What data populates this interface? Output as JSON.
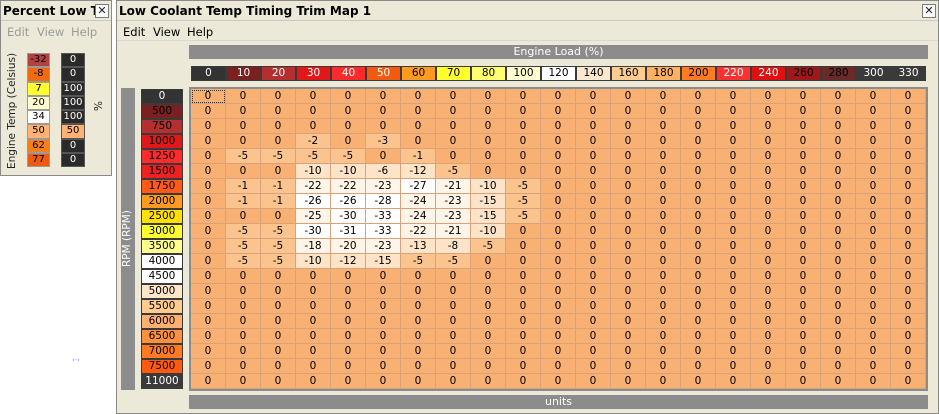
{
  "left_window": {
    "title": "Percent Low T...",
    "close": "✕",
    "menu": [
      "Edit",
      "View",
      "Help"
    ],
    "temp_label": "Engine Temp (Celsius)",
    "pct_label": "%",
    "temps": [
      "-32",
      "-8",
      "7",
      "20",
      "34",
      "50",
      "62",
      "77"
    ],
    "temp_colors": [
      "#b44040",
      "#f26a10",
      "#ffff30",
      "#fffdd0",
      "#ffffff",
      "#ffb273",
      "#f77f1b",
      "#ee5a10"
    ],
    "percents": [
      "0",
      "0",
      "100",
      "100",
      "100",
      "50",
      "0",
      "0"
    ],
    "percent_colors": [
      "#2a2a2a",
      "#2a2a2a",
      "#2a2a2a",
      "#2a2a2a",
      "#2a2a2a",
      "#ffb273",
      "#2a2a2a",
      "#2a2a2a"
    ],
    "percent_text_colors": [
      "#ffffff",
      "#ffffff",
      "#ffffff",
      "#ffffff",
      "#ffffff",
      "#000000",
      "#ffffff",
      "#ffffff"
    ]
  },
  "main_window": {
    "title": "Low Coolant Temp Timing Trim Map 1",
    "close": "✕",
    "menu": [
      "Edit",
      "View",
      "Help"
    ],
    "x_axis_title": "Engine Load (%)",
    "y_axis_title": "RPM (RPM)",
    "units_label": "units",
    "load_axis": [
      "0",
      "10",
      "20",
      "30",
      "40",
      "50",
      "60",
      "70",
      "80",
      "100",
      "120",
      "140",
      "160",
      "180",
      "200",
      "220",
      "240",
      "260",
      "280",
      "300",
      "330"
    ],
    "load_colors": [
      "#333333",
      "#7a2020",
      "#b43030",
      "#e01818",
      "#ff2a2a",
      "#f25a10",
      "#ff9a20",
      "#ffff30",
      "#ffff70",
      "#fffdd0",
      "#ffffff",
      "#fce8d0",
      "#ffcc90",
      "#ffb060",
      "#ff7a20",
      "#ff3030",
      "#e01010",
      "#a01818",
      "#6a2a2a",
      "#3a3a3a",
      "#3a3a3a"
    ],
    "load_text_colors": [
      "#ffffff",
      "#ffffff",
      "#ffffff",
      "#ffffff",
      "#ffffff",
      "#ffffff",
      "#000000",
      "#000000",
      "#000000",
      "#000000",
      "#000000",
      "#000000",
      "#000000",
      "#000000",
      "#000000",
      "#ffffff",
      "#ffffff",
      "#000000",
      "#000000",
      "#ffffff",
      "#ffffff"
    ],
    "rpm_axis": [
      "0",
      "500",
      "750",
      "1000",
      "1250",
      "1500",
      "1750",
      "2000",
      "2500",
      "3000",
      "3500",
      "4000",
      "4500",
      "5000",
      "5500",
      "6000",
      "6500",
      "7000",
      "7500",
      "11000"
    ],
    "rpm_colors": [
      "#333333",
      "#7a2020",
      "#b43030",
      "#e01818",
      "#ff2a2a",
      "#ee2020",
      "#ff5a1a",
      "#ff9a20",
      "#ffe000",
      "#ffff30",
      "#ffff90",
      "#ffffff",
      "#ffffff",
      "#ffe6c8",
      "#ffcc90",
      "#ffb070",
      "#ff9040",
      "#ff7a20",
      "#ff5a10",
      "#3a3a3a"
    ],
    "rpm_text_colors": [
      "#ffffff",
      "#000000",
      "#000000",
      "#000000",
      "#000000",
      "#000000",
      "#000000",
      "#000000",
      "#000000",
      "#000000",
      "#000000",
      "#000000",
      "#000000",
      "#000000",
      "#000000",
      "#000000",
      "#000000",
      "#000000",
      "#000000",
      "#ffffff"
    ],
    "cell_colors": {
      "base": "#f9b073",
      "m1_5": "#fbc48f",
      "m6_15": "#fde3c7",
      "m16_25": "#fff4e8",
      "m26_plus": "#ffffff"
    },
    "table": [
      [
        "0",
        "0",
        "0",
        "0",
        "0",
        "0",
        "0",
        "0",
        "0",
        "0",
        "0",
        "0",
        "0",
        "0",
        "0",
        "0",
        "0",
        "0",
        "0",
        "0",
        "0"
      ],
      [
        "0",
        "0",
        "0",
        "0",
        "0",
        "0",
        "0",
        "0",
        "0",
        "0",
        "0",
        "0",
        "0",
        "0",
        "0",
        "0",
        "0",
        "0",
        "0",
        "0",
        "0"
      ],
      [
        "0",
        "0",
        "0",
        "0",
        "0",
        "0",
        "0",
        "0",
        "0",
        "0",
        "0",
        "0",
        "0",
        "0",
        "0",
        "0",
        "0",
        "0",
        "0",
        "0",
        "0"
      ],
      [
        "0",
        "0",
        "0",
        "-2",
        "0",
        "-3",
        "0",
        "0",
        "0",
        "0",
        "0",
        "0",
        "0",
        "0",
        "0",
        "0",
        "0",
        "0",
        "0",
        "0",
        "0"
      ],
      [
        "0",
        "-5",
        "-5",
        "-5",
        "-5",
        "0",
        "-1",
        "0",
        "0",
        "0",
        "0",
        "0",
        "0",
        "0",
        "0",
        "0",
        "0",
        "0",
        "0",
        "0",
        "0"
      ],
      [
        "0",
        "0",
        "0",
        "-10",
        "-10",
        "-6",
        "-12",
        "-5",
        "0",
        "0",
        "0",
        "0",
        "0",
        "0",
        "0",
        "0",
        "0",
        "0",
        "0",
        "0",
        "0"
      ],
      [
        "0",
        "-1",
        "-1",
        "-22",
        "-22",
        "-23",
        "-27",
        "-21",
        "-10",
        "-5",
        "0",
        "0",
        "0",
        "0",
        "0",
        "0",
        "0",
        "0",
        "0",
        "0",
        "0"
      ],
      [
        "0",
        "-1",
        "-1",
        "-26",
        "-26",
        "-28",
        "-24",
        "-23",
        "-15",
        "-5",
        "0",
        "0",
        "0",
        "0",
        "0",
        "0",
        "0",
        "0",
        "0",
        "0",
        "0"
      ],
      [
        "0",
        "0",
        "0",
        "-25",
        "-30",
        "-33",
        "-24",
        "-23",
        "-15",
        "-5",
        "0",
        "0",
        "0",
        "0",
        "0",
        "0",
        "0",
        "0",
        "0",
        "0",
        "0"
      ],
      [
        "0",
        "-5",
        "-5",
        "-30",
        "-31",
        "-33",
        "-22",
        "-21",
        "-10",
        "0",
        "0",
        "0",
        "0",
        "0",
        "0",
        "0",
        "0",
        "0",
        "0",
        "0",
        "0"
      ],
      [
        "0",
        "-5",
        "-5",
        "-18",
        "-20",
        "-23",
        "-13",
        "-8",
        "-5",
        "0",
        "0",
        "0",
        "0",
        "0",
        "0",
        "0",
        "0",
        "0",
        "0",
        "0",
        "0"
      ],
      [
        "0",
        "-5",
        "-5",
        "-10",
        "-12",
        "-15",
        "-5",
        "-5",
        "0",
        "0",
        "0",
        "0",
        "0",
        "0",
        "0",
        "0",
        "0",
        "0",
        "0",
        "0",
        "0"
      ],
      [
        "0",
        "0",
        "0",
        "0",
        "0",
        "0",
        "0",
        "0",
        "0",
        "0",
        "0",
        "0",
        "0",
        "0",
        "0",
        "0",
        "0",
        "0",
        "0",
        "0",
        "0"
      ],
      [
        "0",
        "0",
        "0",
        "0",
        "0",
        "0",
        "0",
        "0",
        "0",
        "0",
        "0",
        "0",
        "0",
        "0",
        "0",
        "0",
        "0",
        "0",
        "0",
        "0",
        "0"
      ],
      [
        "0",
        "0",
        "0",
        "0",
        "0",
        "0",
        "0",
        "0",
        "0",
        "0",
        "0",
        "0",
        "0",
        "0",
        "0",
        "0",
        "0",
        "0",
        "0",
        "0",
        "0"
      ],
      [
        "0",
        "0",
        "0",
        "0",
        "0",
        "0",
        "0",
        "0",
        "0",
        "0",
        "0",
        "0",
        "0",
        "0",
        "0",
        "0",
        "0",
        "0",
        "0",
        "0",
        "0"
      ],
      [
        "0",
        "0",
        "0",
        "0",
        "0",
        "0",
        "0",
        "0",
        "0",
        "0",
        "0",
        "0",
        "0",
        "0",
        "0",
        "0",
        "0",
        "0",
        "0",
        "0",
        "0"
      ],
      [
        "0",
        "0",
        "0",
        "0",
        "0",
        "0",
        "0",
        "0",
        "0",
        "0",
        "0",
        "0",
        "0",
        "0",
        "0",
        "0",
        "0",
        "0",
        "0",
        "0",
        "0"
      ],
      [
        "0",
        "0",
        "0",
        "0",
        "0",
        "0",
        "0",
        "0",
        "0",
        "0",
        "0",
        "0",
        "0",
        "0",
        "0",
        "0",
        "0",
        "0",
        "0",
        "0",
        "0"
      ],
      [
        "0",
        "0",
        "0",
        "0",
        "0",
        "0",
        "0",
        "0",
        "0",
        "0",
        "0",
        "0",
        "0",
        "0",
        "0",
        "0",
        "0",
        "0",
        "0",
        "0",
        "0"
      ]
    ]
  },
  "stray_text": "‹·›"
}
